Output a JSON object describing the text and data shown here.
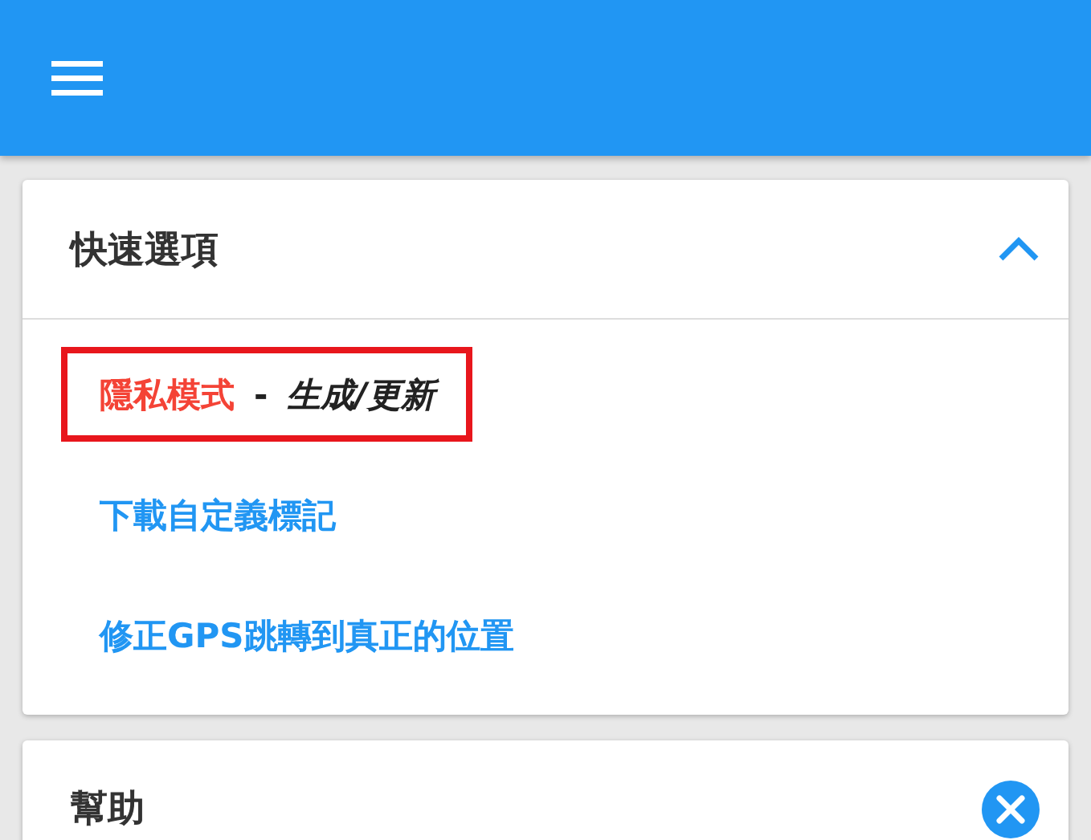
{
  "sections": [
    {
      "title": "快速選項",
      "expanded": true,
      "kind": "collapsible",
      "items": [
        {
          "label": "隱私模式",
          "separator": "-",
          "detail": "生成/更新",
          "highlighted": true,
          "color": "#f44336"
        },
        {
          "label": "下載自定義標記",
          "highlighted": false,
          "color": "#2196f3"
        },
        {
          "label": "修正GPS跳轉到真正的位置",
          "highlighted": false,
          "color": "#2196f3"
        }
      ]
    },
    {
      "title": "幫助",
      "expanded": false,
      "kind": "closable"
    }
  ]
}
